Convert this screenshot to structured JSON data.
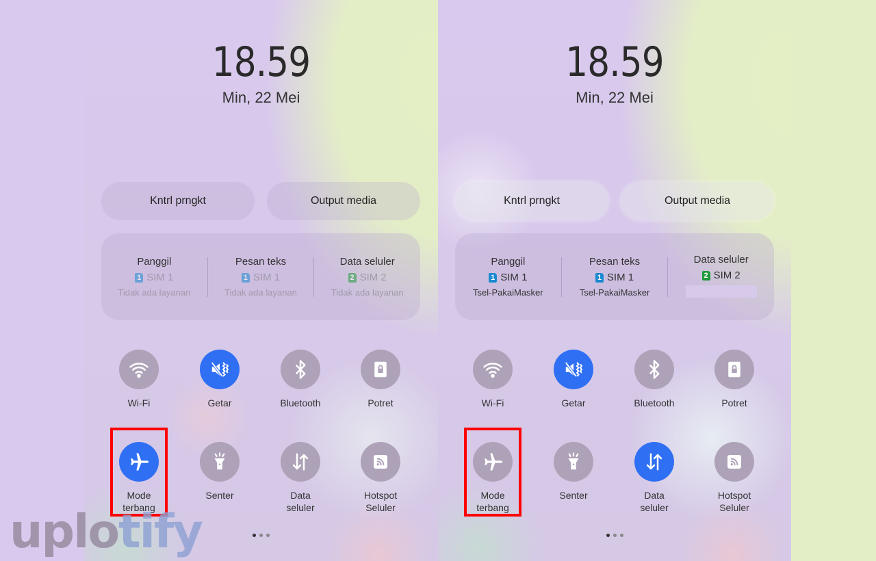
{
  "colors": {
    "accent_on": "#2f6ff3",
    "tile_off": "#aea2b8",
    "highlight": "#ff0000",
    "sim1_badge": "#1a8ad0",
    "sim2_badge": "#1f9a3a"
  },
  "watermark": {
    "part1": "uplo",
    "part2": "tify"
  },
  "panels": [
    {
      "clock": "18.59",
      "date": "Min, 22 Mei",
      "buttons": {
        "device_control": "Kntrl prngkt",
        "media_output": "Output media"
      },
      "sim": [
        {
          "title": "Panggil",
          "badge": "1",
          "sim": "SIM 1",
          "status": "Tidak ada layanan"
        },
        {
          "title": "Pesan teks",
          "badge": "1",
          "sim": "SIM 1",
          "status": "Tidak ada layanan"
        },
        {
          "title": "Data seluler",
          "badge": "2",
          "sim": "SIM 2",
          "status": "Tidak ada layanan"
        }
      ],
      "tiles": [
        {
          "label": "Wi-Fi",
          "icon": "wifi-icon",
          "on": false
        },
        {
          "label": "Getar",
          "icon": "vibrate-icon",
          "on": true
        },
        {
          "label": "Bluetooth",
          "icon": "bluetooth-icon",
          "on": false
        },
        {
          "label": "Potret",
          "icon": "portrait-lock-icon",
          "on": false
        },
        {
          "label": "Mode terbang",
          "icon": "airplane-icon",
          "on": true
        },
        {
          "label": "Senter",
          "icon": "flashlight-icon",
          "on": false
        },
        {
          "label": "Data seluler",
          "icon": "mobile-data-icon",
          "on": false
        },
        {
          "label": "Hotspot Seluler",
          "icon": "hotspot-icon",
          "on": false
        }
      ],
      "page_indicator": {
        "pages": 3,
        "current": 1
      }
    },
    {
      "clock": "18.59",
      "date": "Min, 22 Mei",
      "buttons": {
        "device_control": "Kntrl prngkt",
        "media_output": "Output media"
      },
      "sim": [
        {
          "title": "Panggil",
          "badge": "1",
          "sim": "SIM 1",
          "status": "Tsel-PakaiMasker"
        },
        {
          "title": "Pesan teks",
          "badge": "1",
          "sim": "SIM 1",
          "status": "Tsel-PakaiMasker"
        },
        {
          "title": "Data seluler",
          "badge": "2",
          "sim": "SIM 2",
          "status": ""
        }
      ],
      "tiles": [
        {
          "label": "Wi-Fi",
          "icon": "wifi-icon",
          "on": false
        },
        {
          "label": "Getar",
          "icon": "vibrate-icon",
          "on": true
        },
        {
          "label": "Bluetooth",
          "icon": "bluetooth-icon",
          "on": false
        },
        {
          "label": "Potret",
          "icon": "portrait-lock-icon",
          "on": false
        },
        {
          "label": "Mode terbang",
          "icon": "airplane-icon",
          "on": false
        },
        {
          "label": "Senter",
          "icon": "flashlight-icon",
          "on": false
        },
        {
          "label": "Data seluler",
          "icon": "mobile-data-icon",
          "on": true
        },
        {
          "label": "Hotspot Seluler",
          "icon": "hotspot-icon",
          "on": false
        }
      ],
      "page_indicator": {
        "pages": 3,
        "current": 1
      }
    }
  ]
}
